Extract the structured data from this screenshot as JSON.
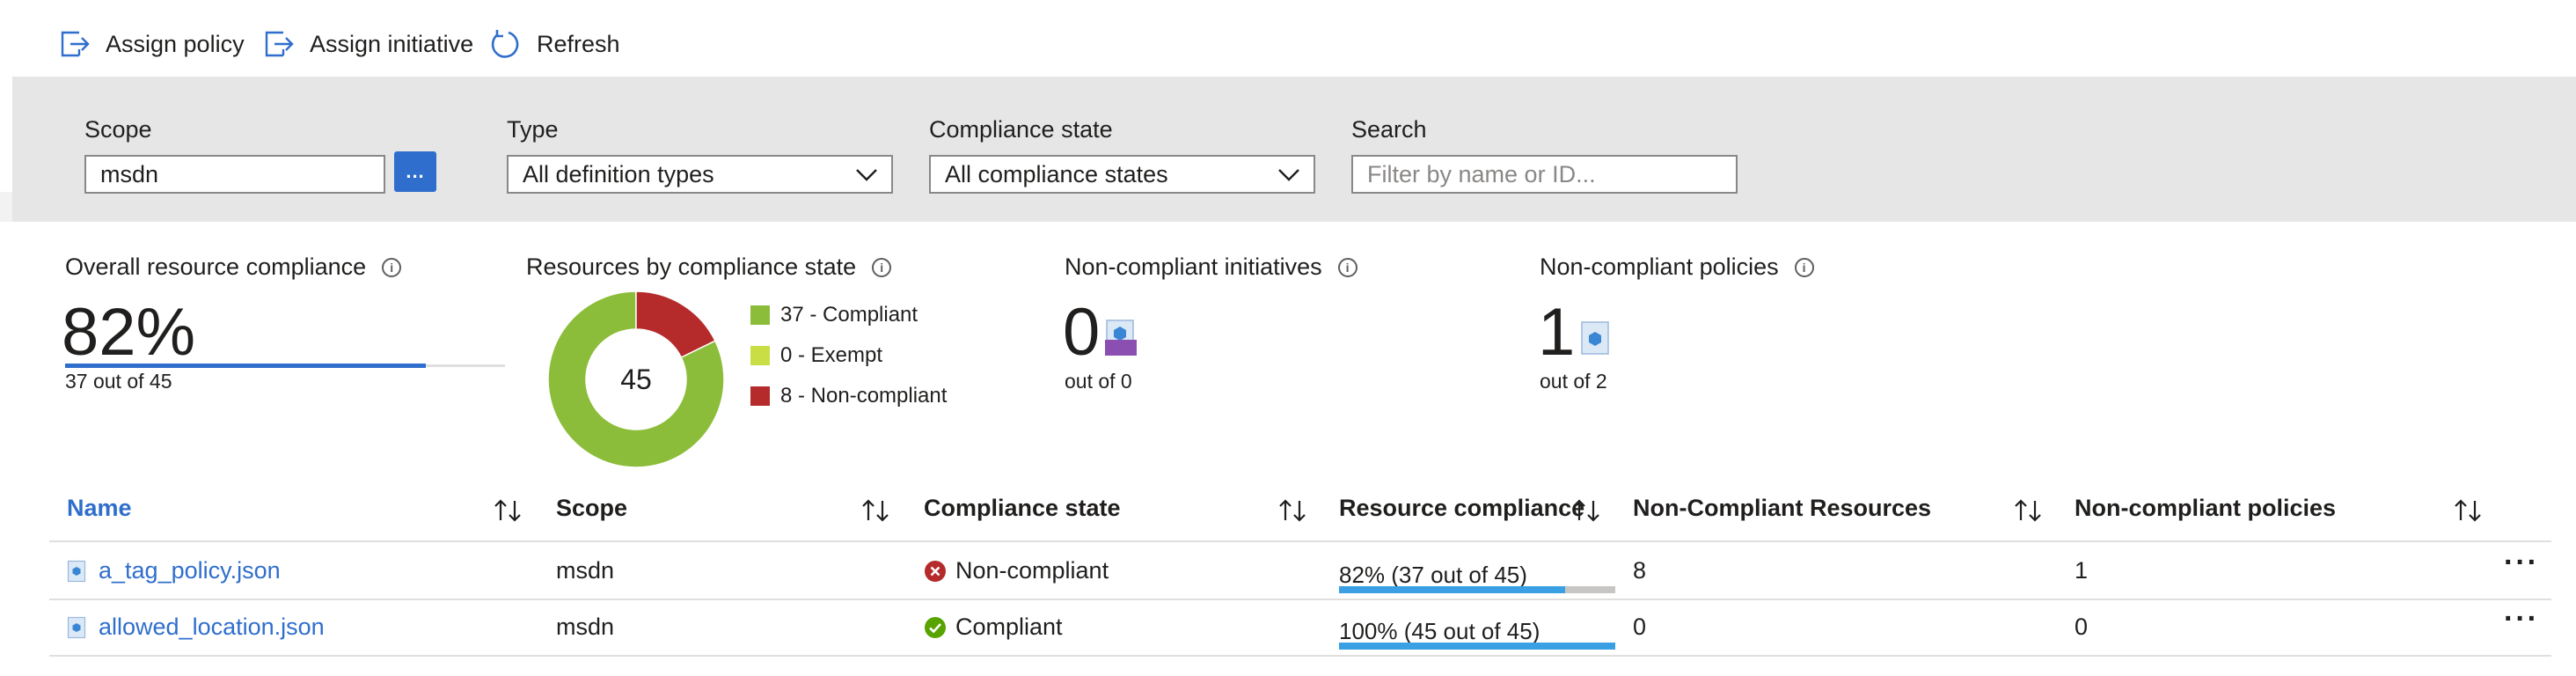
{
  "toolbar": {
    "assign_policy": "Assign policy",
    "assign_initiative": "Assign initiative",
    "refresh": "Refresh"
  },
  "filters": {
    "scope_label": "Scope",
    "scope_value": "msdn",
    "scope_button": "...",
    "type_label": "Type",
    "type_value": "All definition types",
    "compliance_label": "Compliance state",
    "compliance_value": "All compliance states",
    "search_label": "Search",
    "search_placeholder": "Filter by name or ID..."
  },
  "summary": {
    "overall": {
      "title": "Overall resource compliance",
      "value": "82%",
      "fraction": 0.82,
      "subtext": "37 out of 45"
    },
    "by_state": {
      "title": "Resources by compliance state",
      "total": "45",
      "legend": [
        {
          "label": "37 - Compliant",
          "value": 37,
          "color": "#8cbd3a"
        },
        {
          "label": "0 - Exempt",
          "value": 0,
          "color": "#c9de45"
        },
        {
          "label": "8 - Non-compliant",
          "value": 8,
          "color": "#b52a2a"
        }
      ]
    },
    "initiatives": {
      "title": "Non-compliant initiatives",
      "value": "0",
      "subtext": "out of 0"
    },
    "policies": {
      "title": "Non-compliant policies",
      "value": "1",
      "subtext": "out of 2"
    }
  },
  "table": {
    "headers": {
      "name": "Name",
      "scope": "Scope",
      "state": "Compliance state",
      "resource_compliance": "Resource compliance",
      "noncompliant_resources": "Non-Compliant Resources",
      "noncompliant_policies": "Non-compliant policies"
    },
    "rows": [
      {
        "name": "a_tag_policy.json",
        "scope": "msdn",
        "state": "Non-compliant",
        "compliance_text": "82% (37 out of 45)",
        "compliance_fraction": 0.82,
        "noncompliant_resources": "8",
        "noncompliant_policies": "1"
      },
      {
        "name": "allowed_location.json",
        "scope": "msdn",
        "state": "Compliant",
        "compliance_text": "100% (45 out of 45)",
        "compliance_fraction": 1.0,
        "noncompliant_resources": "0",
        "noncompliant_policies": "0"
      }
    ],
    "more_label": "···"
  },
  "colors": {
    "accent": "#2f6ecc",
    "compliant": "#8cbd3a",
    "noncompliant": "#b52a2a",
    "bar": "#3aa0e3"
  }
}
